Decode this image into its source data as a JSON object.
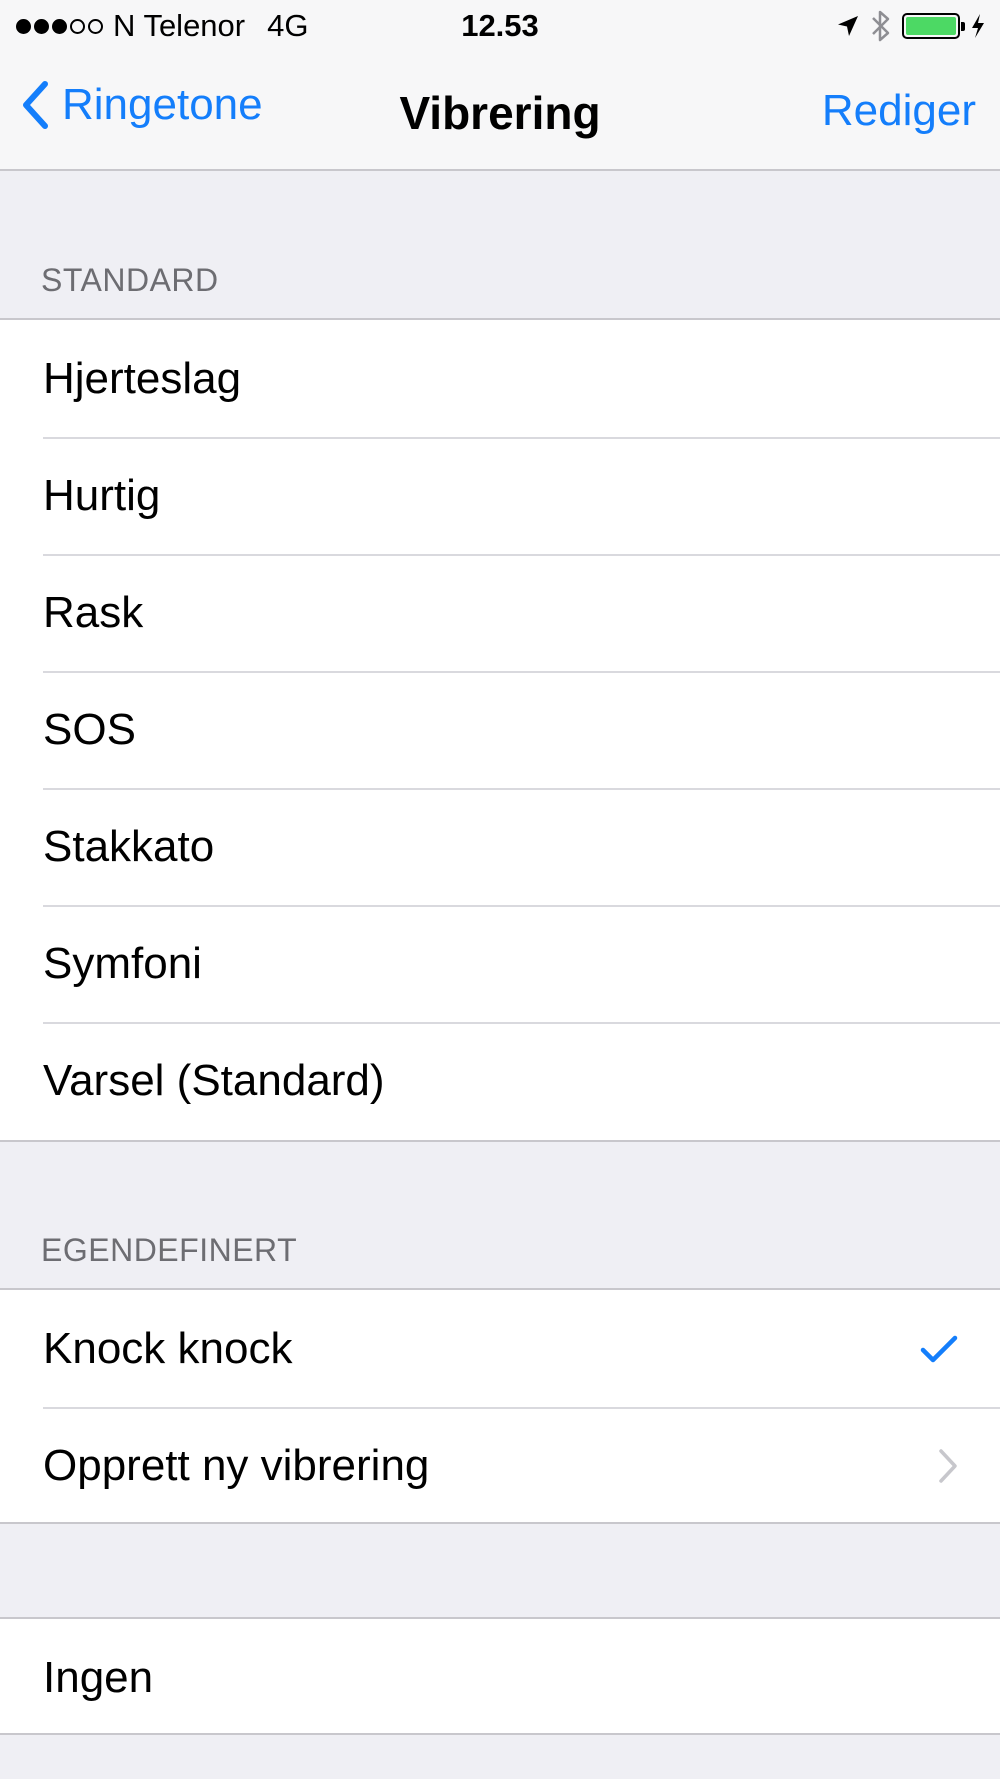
{
  "status_bar": {
    "carrier": "N Telenor",
    "network": "4G",
    "time": "12.53",
    "signal_bars_filled": 3,
    "signal_bars_total": 5,
    "battery_color": "#4cd964"
  },
  "nav": {
    "back_label": "Ringetone",
    "title": "Vibrering",
    "right_label": "Rediger",
    "accent_color": "#147efb"
  },
  "sections": {
    "standard": {
      "header": "STANDARD",
      "items": [
        {
          "label": "Hjerteslag"
        },
        {
          "label": "Hurtig"
        },
        {
          "label": "Rask"
        },
        {
          "label": "SOS"
        },
        {
          "label": "Stakkato"
        },
        {
          "label": "Symfoni"
        },
        {
          "label": "Varsel (Standard)"
        }
      ]
    },
    "custom": {
      "header": "EGENDEFINERT",
      "items": [
        {
          "label": "Knock knock",
          "accessory": "checkmark-icon",
          "selected": true
        },
        {
          "label": "Opprett ny vibrering",
          "accessory": "chevron-right-icon"
        }
      ]
    },
    "none": {
      "items": [
        {
          "label": "Ingen"
        }
      ]
    }
  }
}
